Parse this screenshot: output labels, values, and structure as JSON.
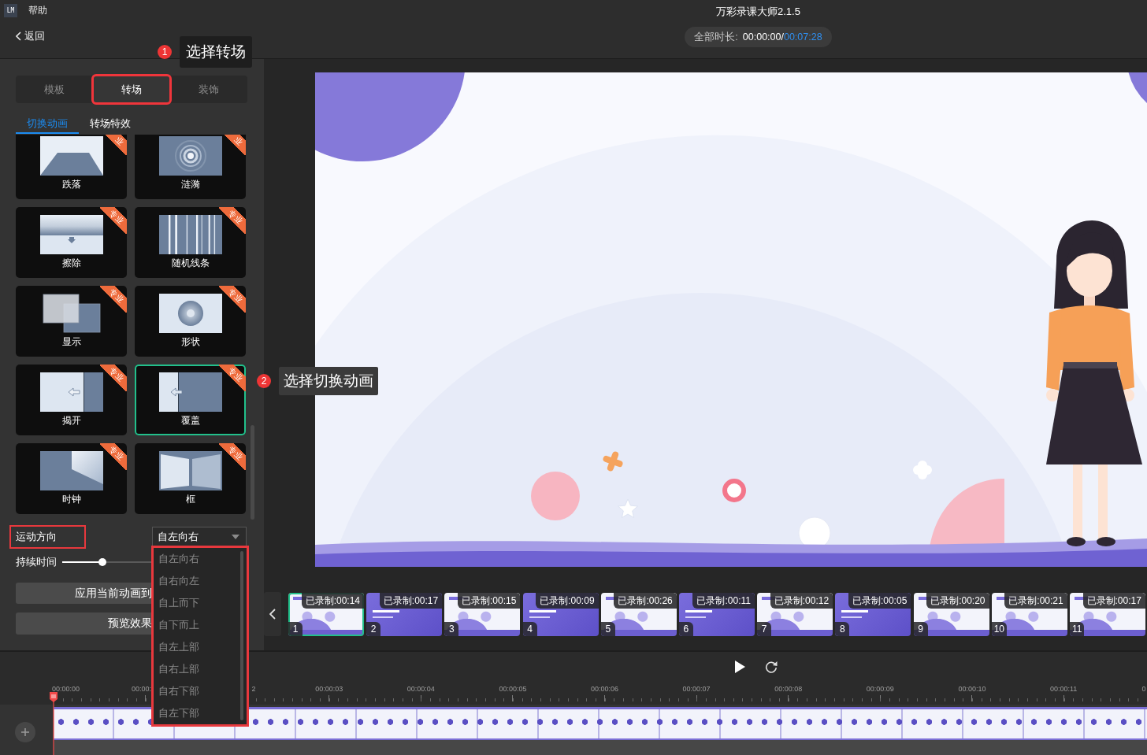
{
  "app": {
    "logo": "LM",
    "menu": [
      "帮助"
    ],
    "title": "万彩录课大师2.1.5"
  },
  "back_button": {
    "label": "返回"
  },
  "total_duration": {
    "label": "全部时长:",
    "current": "00:00:00/",
    "total": "00:07:28"
  },
  "annotations": [
    {
      "number": "1",
      "text": "选择转场"
    },
    {
      "number": "2",
      "text": "选择切换动画"
    }
  ],
  "panel": {
    "tabs": [
      {
        "label": "模板",
        "selected": false,
        "highlighted": false
      },
      {
        "label": "转场",
        "selected": true,
        "highlighted": true
      },
      {
        "label": "装饰",
        "selected": false,
        "highlighted": false
      }
    ],
    "subtabs": [
      {
        "label": "切换动画",
        "selected": true
      },
      {
        "label": "转场特效",
        "selected": false
      }
    ],
    "transitions": [
      {
        "name": "跌落",
        "kind": "fall",
        "badge": "业",
        "selected": false
      },
      {
        "name": "涟漪",
        "kind": "ripple",
        "badge": "业",
        "selected": false
      },
      {
        "name": "擦除",
        "kind": "wipe",
        "badge": "专业",
        "selected": false
      },
      {
        "name": "随机线条",
        "kind": "lines",
        "badge": "专业",
        "selected": false
      },
      {
        "name": "显示",
        "kind": "reveal",
        "badge": "专业",
        "selected": false
      },
      {
        "name": "形状",
        "kind": "shape",
        "badge": "专业",
        "selected": false
      },
      {
        "name": "揭开",
        "kind": "uncover",
        "badge": "专业",
        "selected": false
      },
      {
        "name": "覆盖",
        "kind": "cover",
        "badge": "专业",
        "selected": true
      },
      {
        "name": "时钟",
        "kind": "clock",
        "badge": "专业",
        "selected": false
      },
      {
        "name": "框",
        "kind": "frame",
        "badge": "专业",
        "selected": false
      }
    ],
    "direction": {
      "label": "运动方向",
      "label_highlighted": true,
      "value": "自左向右",
      "open": true,
      "list_highlighted": true,
      "options": [
        "自左向右",
        "自右向左",
        "自上而下",
        "自下而上",
        "自左上部",
        "自右上部",
        "自右下部",
        "自左下部"
      ]
    },
    "duration": {
      "label": "持续时间",
      "level": 0.22
    },
    "buttons": [
      "应用当前动画到",
      "预览效果"
    ]
  },
  "filmstrip": [
    {
      "duration": "已录制:00:14",
      "number": "1",
      "kind": "light",
      "selected": true
    },
    {
      "duration": "已录制:00:17",
      "number": "2",
      "kind": "purple",
      "selected": false
    },
    {
      "duration": "已录制:00:15",
      "number": "3",
      "kind": "light",
      "selected": false
    },
    {
      "duration": "已录制:00:09",
      "number": "4",
      "kind": "purple",
      "selected": false
    },
    {
      "duration": "已录制:00:26",
      "number": "5",
      "kind": "light",
      "selected": false
    },
    {
      "duration": "已录制:00:11",
      "number": "6",
      "kind": "purple",
      "selected": false
    },
    {
      "duration": "已录制:00:12",
      "number": "7",
      "kind": "light",
      "selected": false
    },
    {
      "duration": "已录制:00:05",
      "number": "8",
      "kind": "purple",
      "selected": false
    },
    {
      "duration": "已录制:00:20",
      "number": "9",
      "kind": "light",
      "selected": false
    },
    {
      "duration": "已录制:00:21",
      "number": "10",
      "kind": "light",
      "selected": false
    },
    {
      "duration": "已录制:00:17",
      "number": "11",
      "kind": "light",
      "selected": false
    }
  ],
  "timeline": {
    "ruler": [
      "00:00:00",
      "00:00:",
      "2",
      "00:00:03",
      "00:00:04",
      "00:00:05",
      "00:00:06",
      "00:00:07",
      "00:00:08",
      "00:00:09",
      "00:00:10",
      "00:00:11",
      "0"
    ]
  }
}
